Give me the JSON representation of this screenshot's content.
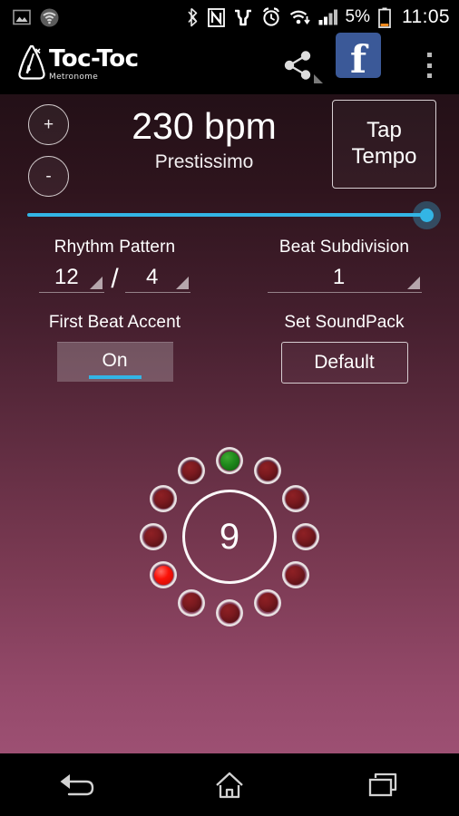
{
  "status_bar": {
    "left_icons": [
      "screenshot-icon",
      "wifi-circle-icon"
    ],
    "right_icons": [
      "bluetooth-icon",
      "nfc-icon",
      "glove-icon",
      "alarm-clock-icon",
      "wifi-icon",
      "signal-bars-icon"
    ],
    "battery_percent": "5%",
    "time": "11:05"
  },
  "action_bar": {
    "app_name": "Toc-Toc",
    "app_subtitle": "Metronome",
    "share_icon": "share-icon",
    "facebook_letter": "f",
    "overflow_icon": "overflow-menu-icon"
  },
  "tempo": {
    "increase_label": "+",
    "decrease_label": "-",
    "bpm_value": "230 bpm",
    "tempo_name": "Prestissimo",
    "tap_tempo_label": "Tap\nTempo",
    "tap_tempo_line1": "Tap",
    "tap_tempo_line2": "Tempo",
    "slider_percent": 100,
    "slider_color": "#33b5e5"
  },
  "controls": {
    "rhythm_pattern_label": "Rhythm Pattern",
    "rhythm_numerator": "12",
    "rhythm_separator": "/",
    "rhythm_denominator": "4",
    "beat_subdivision_label": "Beat Subdivision",
    "beat_subdivision_value": "1",
    "first_beat_accent_label": "First Beat Accent",
    "first_beat_accent_value": "On",
    "set_soundpack_label": "Set SoundPack",
    "set_soundpack_value": "Default"
  },
  "beat_display": {
    "current_beat": "9",
    "total_beats": 12,
    "leds": [
      {
        "index": 1,
        "state": "first"
      },
      {
        "index": 2,
        "state": "off"
      },
      {
        "index": 3,
        "state": "off"
      },
      {
        "index": 4,
        "state": "off"
      },
      {
        "index": 5,
        "state": "off"
      },
      {
        "index": 6,
        "state": "off"
      },
      {
        "index": 7,
        "state": "off"
      },
      {
        "index": 8,
        "state": "off"
      },
      {
        "index": 9,
        "state": "active"
      },
      {
        "index": 10,
        "state": "off"
      },
      {
        "index": 11,
        "state": "off"
      },
      {
        "index": 12,
        "state": "off"
      }
    ],
    "colors": {
      "first": "#1f8a1c",
      "active": "#fb1208",
      "off": "#7b1a1f"
    }
  },
  "nav_bar": {
    "back_icon": "back-icon",
    "home_icon": "home-icon",
    "recents_icon": "recents-icon"
  },
  "theme": {
    "background_top": "#231017",
    "background_bottom": "#9d5073",
    "accent": "#33b5e5",
    "facebook_blue": "#3b5998"
  }
}
